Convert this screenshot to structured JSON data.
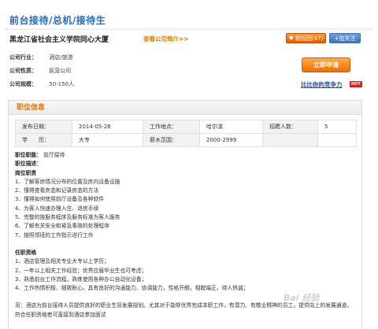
{
  "header": {
    "title": "前台接待/总机/接待生"
  },
  "company": {
    "name": "黑龙江省社会主义学院同心大厦",
    "view_link": "查看公司简介>>",
    "fav_icon": "heart-icon",
    "fav_label": "前程团(47)",
    "follow_label": "+加关注"
  },
  "info": {
    "industry_key": "公司行业：",
    "industry_val": "酒店/旅游",
    "nature_key": "公司性质：",
    "nature_val": "民营公司",
    "size_key": "公司规模：",
    "size_val": "50-150人"
  },
  "actions": {
    "apply_label": "立即申请",
    "compete_label": "比比你的竞争力",
    "hot_badge": "HOT"
  },
  "panel": {
    "title": "职位信息",
    "meta": {
      "date_key": "发布日期：",
      "date_val": "2014-05-26",
      "place_key": "工作地点：",
      "place_val": "哈尔滨",
      "count_key": "招聘人数：",
      "count_val": "5",
      "edu_key": "学　　历：",
      "edu_val": "大专",
      "salary_key": "薪水范围：",
      "salary_val": "2000-2999"
    },
    "job_function_key": "职位职能：",
    "job_function_val": "前厅接待",
    "desc_key": "职位描述：",
    "duty_title": "岗位职责",
    "duties": [
      "1、了解客房情况分布的位置及房内设备设施",
      "2、懂得查看房态和记录房态的方法",
      "3、懂得如何使用前厅设备及各种软件",
      "4、为客人快速办理入住、退房手续",
      "5、完整的按服务程序及服务标准为客人服务",
      "6、了解有关安全和紧急事故的处理程序",
      "7、按照领班的工作指示进行工作"
    ],
    "req_title": "任职资格",
    "reqs": [
      "1、酒店管理及相关专业大专以上学历；",
      "2、一年以上相关工作经验；优秀应届毕业生也可考虑；",
      "3、熟悉前台工作流程，熟练使用各种办公自动化设备；",
      "4、工作热情积极、细致耐心，具有良好的沟通能力、协调能力，性格开朗，相貌端正，待人热诚；"
    ],
    "note": "另：酒店为前台接待人员提供良好的职业生涯发展规划。尤其对于能够优秀完成本职工作，有潜力、有敬业精神的员工，提供向上的发展通道，符合任职资格者可直接到酒店参加面试"
  },
  "watermark": "Bai 经验"
}
